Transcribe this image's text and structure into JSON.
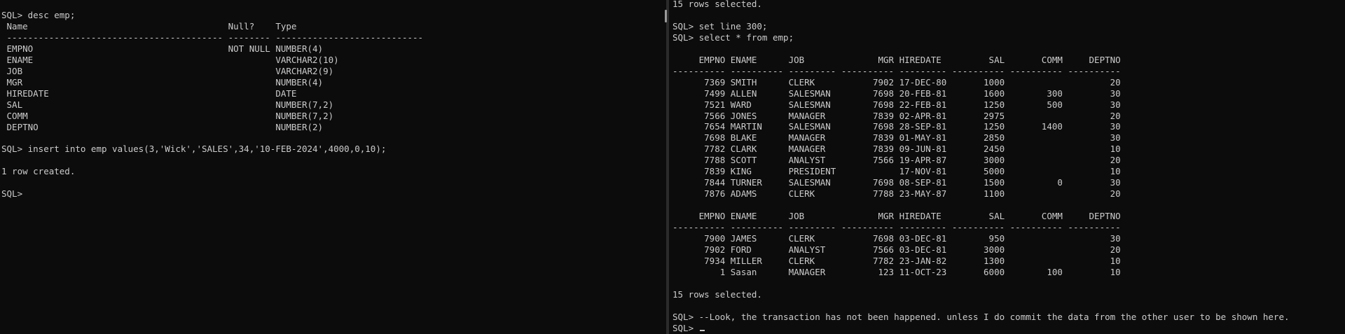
{
  "left_terminal": {
    "lines": [
      "SQL> desc emp;",
      " Name                                      Null?    Type",
      " ----------------------------------------- -------- ----------------------------",
      " EMPNO                                     NOT NULL NUMBER(4)",
      " ENAME                                              VARCHAR2(10)",
      " JOB                                                VARCHAR2(9)",
      " MGR                                                NUMBER(4)",
      " HIREDATE                                           DATE",
      " SAL                                                NUMBER(7,2)",
      " COMM                                               NUMBER(7,2)",
      " DEPTNO                                             NUMBER(2)",
      "",
      "SQL> insert into emp values(3,'Wick','SALES',34,'10-FEB-2024',4000,0,10);",
      "",
      "1 row created.",
      "",
      "SQL>"
    ]
  },
  "right_terminal": {
    "lines": [
      "15 rows selected.",
      "",
      "SQL> set line 300;",
      "SQL> select * from emp;",
      "",
      "     EMPNO ENAME      JOB              MGR HIREDATE         SAL       COMM     DEPTNO",
      "---------- ---------- --------- ---------- --------- ---------- ---------- ----------",
      "      7369 SMITH      CLERK           7902 17-DEC-80       1000                    20",
      "      7499 ALLEN      SALESMAN        7698 20-FEB-81       1600        300         30",
      "      7521 WARD       SALESMAN        7698 22-FEB-81       1250        500         30",
      "      7566 JONES      MANAGER         7839 02-APR-81       2975                    20",
      "      7654 MARTIN     SALESMAN        7698 28-SEP-81       1250       1400         30",
      "      7698 BLAKE      MANAGER         7839 01-MAY-81       2850                    30",
      "      7782 CLARK      MANAGER         7839 09-JUN-81       2450                    10",
      "      7788 SCOTT      ANALYST         7566 19-APR-87       3000                    20",
      "      7839 KING       PRESIDENT            17-NOV-81       5000                    10",
      "      7844 TURNER     SALESMAN        7698 08-SEP-81       1500          0         30",
      "      7876 ADAMS      CLERK           7788 23-MAY-87       1100                    20",
      "",
      "     EMPNO ENAME      JOB              MGR HIREDATE         SAL       COMM     DEPTNO",
      "---------- ---------- --------- ---------- --------- ---------- ---------- ----------",
      "      7900 JAMES      CLERK           7698 03-DEC-81        950                    30",
      "      7902 FORD       ANALYST         7566 03-DEC-81       3000                    20",
      "      7934 MILLER     CLERK           7782 23-JAN-82       1300                    10",
      "         1 Sasan      MANAGER          123 11-OCT-23       6000        100         10",
      "",
      "15 rows selected.",
      "",
      "SQL> --Look, the transaction has not been happened. unless I do commit the data from the other user to be shown here.",
      "SQL> "
    ]
  },
  "colors": {
    "background": "#0c0c0c",
    "text": "#cccccc",
    "divider": "#2b2b2b"
  }
}
